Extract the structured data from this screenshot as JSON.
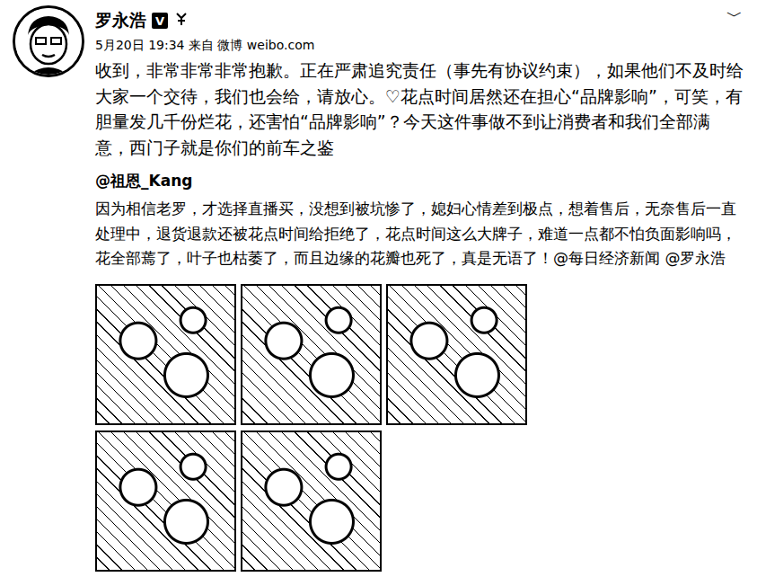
{
  "author": {
    "name": "罗永浩",
    "verified_badge": "V"
  },
  "menu": "﹀",
  "meta": "5月20日 19:34 来自 微博 weibo.com",
  "post": {
    "text_before": "收到，非常非常非常抱歉。正在严肃追究责任（事先有协议约束），如果他们不及时给大家一个交待，我们也会给，请放心。",
    "heart": "♡",
    "text_after": "花点时间居然还在担心“品牌影响”，可笑，有胆量发几千份烂花，还害怕“品牌影响”？今天这件事做不到让消费者和我们全部满意，西门子就是你们的前车之鉴"
  },
  "repost": {
    "author": "@祖恩_Kang",
    "text": "因为相信老罗，才选择直播买，没想到被坑惨了，媳妇心情差到极点，想着售后，无奈售后一直处理中，退货退款还被花点时间给拒绝了，花点时间这么大牌子，难道一点都不怕负面影响吗，花全部蔫了，叶子也枯萎了，而且边缘的花瓣也死了，真是无语了！@每日经济新闻 @罗永浩"
  }
}
